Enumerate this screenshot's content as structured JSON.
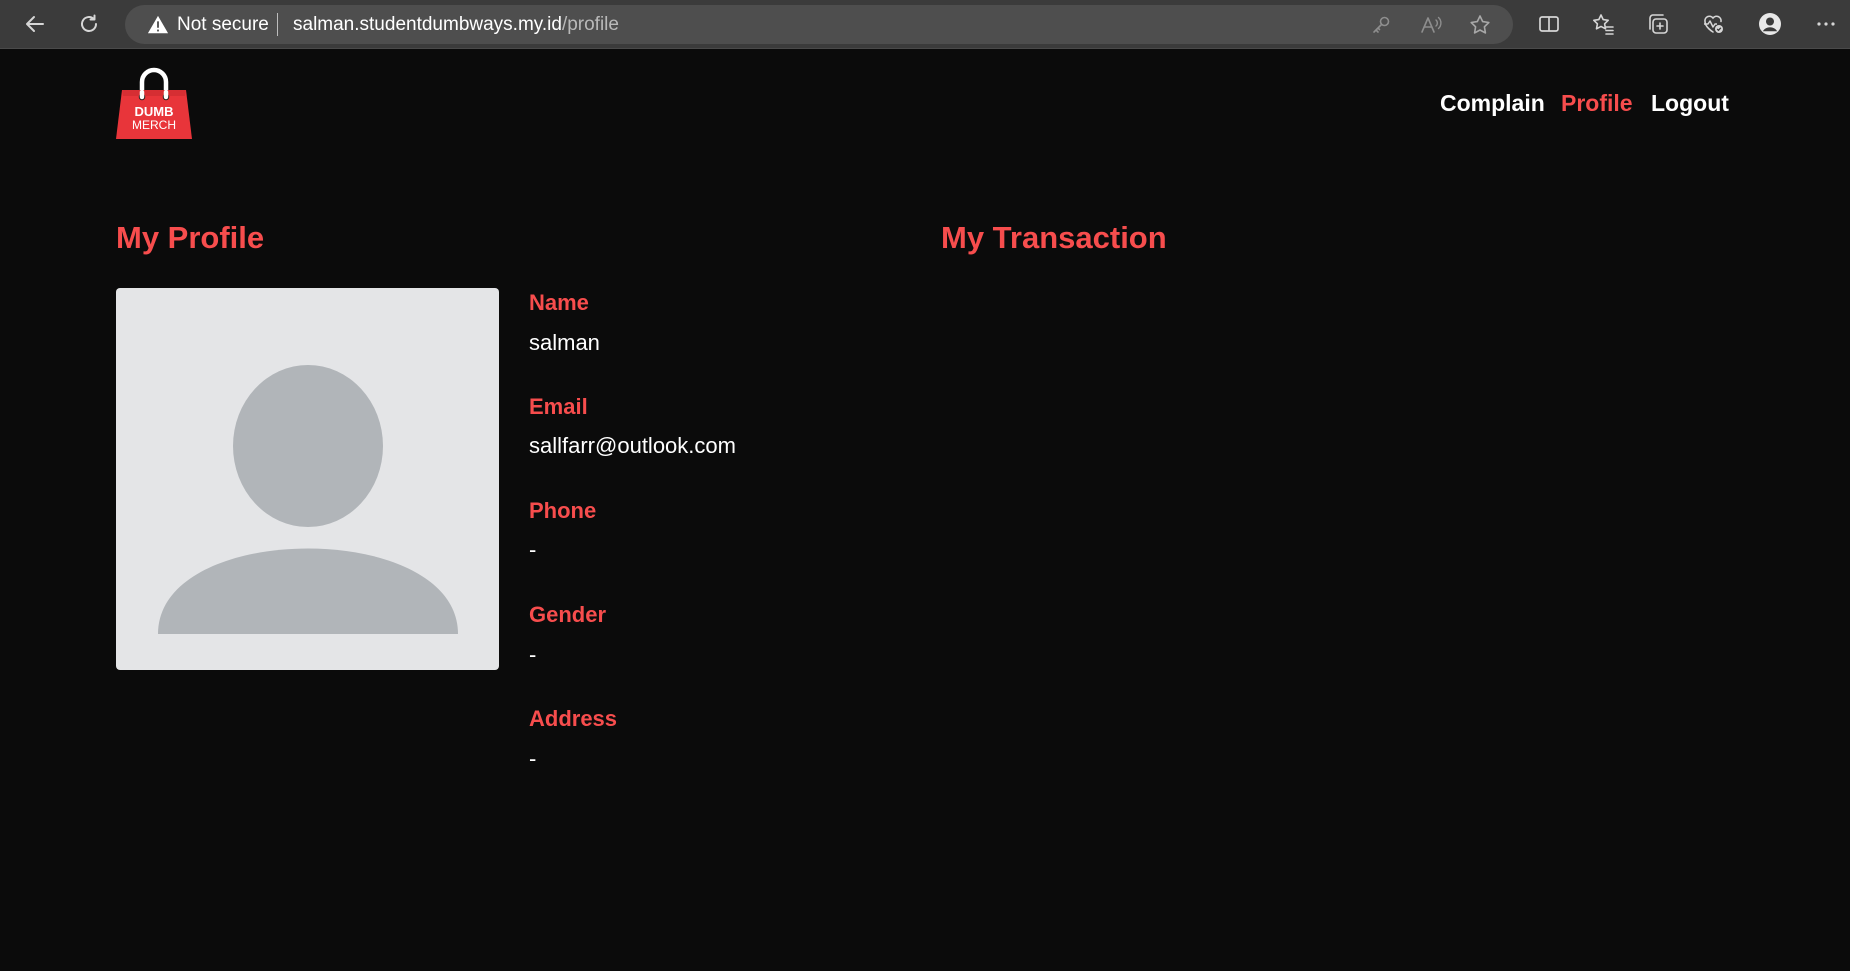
{
  "browser": {
    "security_label": "Not secure",
    "url_host": "salman.studentdumbways.my.id",
    "url_path": "/profile",
    "icons": [
      "back-icon",
      "refresh-icon",
      "warning-icon",
      "key-icon",
      "read-aloud-icon",
      "favorite-star-icon",
      "split-screen-icon",
      "favorites-list-icon",
      "collections-icon",
      "browser-essentials-icon",
      "profile-icon",
      "more-icon"
    ]
  },
  "logo": {
    "line1": "DUMB",
    "line2": "MERCH",
    "color": "#e8353a"
  },
  "nav": {
    "complain": "Complain",
    "profile": "Profile",
    "logout": "Logout",
    "active": "profile"
  },
  "profile": {
    "title": "My Profile",
    "fields": [
      {
        "label": "Name",
        "value": "salman"
      },
      {
        "label": "Email",
        "value": "sallfarr@outlook.com"
      },
      {
        "label": "Phone",
        "value": "-"
      },
      {
        "label": "Gender",
        "value": "-"
      },
      {
        "label": "Address",
        "value": "-"
      }
    ]
  },
  "transactions": {
    "title": "My Transaction",
    "items": []
  },
  "colors": {
    "accent": "#f74d4d",
    "background": "#0b0b0b",
    "avatar_bg": "#e4e5e7",
    "avatar_fg": "#b1b5b9"
  }
}
